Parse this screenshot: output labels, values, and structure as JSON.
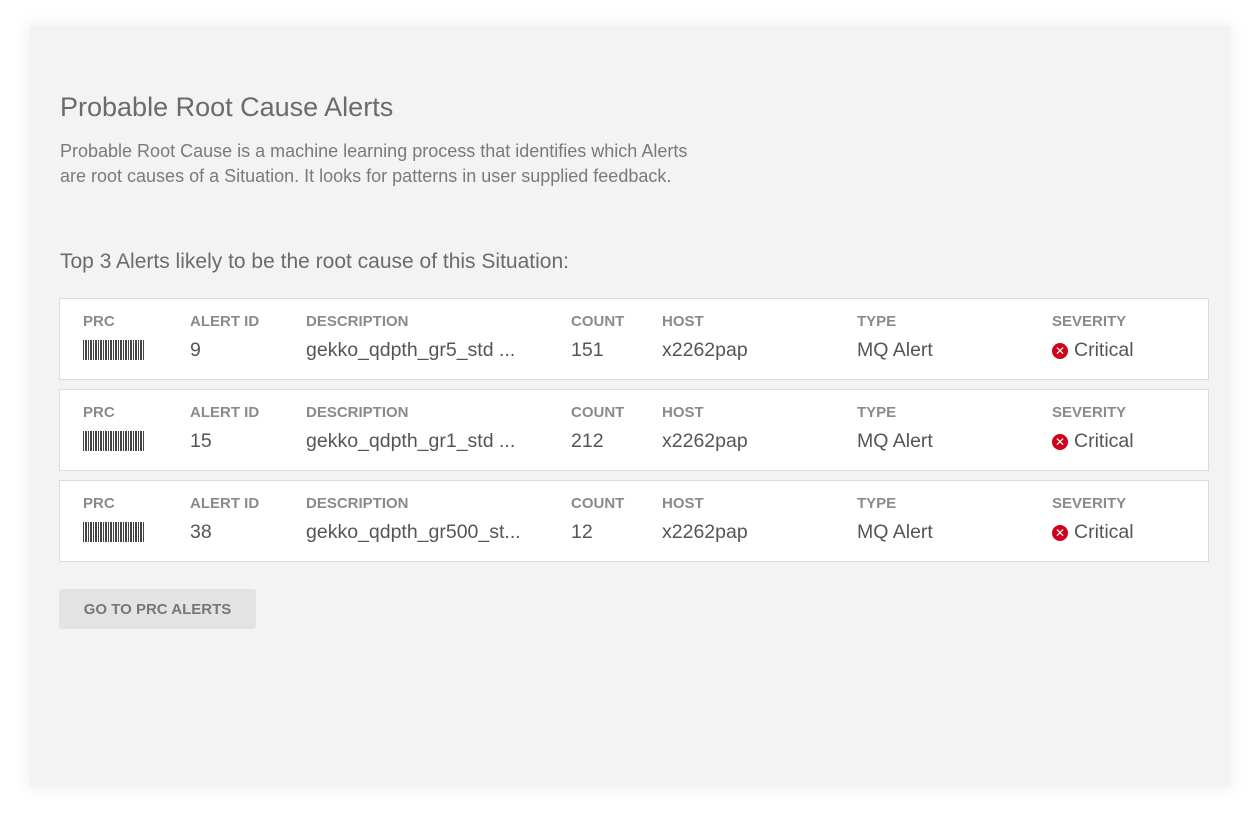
{
  "page": {
    "title": "Probable Root Cause Alerts",
    "intro": "Probable Root Cause is a machine learning process that identifies which Alerts are root causes of a Situation. It looks for patterns in user supplied feedback.",
    "subheading": "Top 3 Alerts likely to be the root cause of this Situation:"
  },
  "columns": {
    "prc": "PRC",
    "alert_id": "ALERT ID",
    "description": "DESCRIPTION",
    "count": "COUNT",
    "host": "HOST",
    "type": "TYPE",
    "severity": "SEVERITY"
  },
  "alerts": [
    {
      "alert_id": "9",
      "description": "gekko_qdpth_gr5_std ...",
      "count": "151",
      "host": "x2262pap",
      "type": "MQ Alert",
      "severity": "Critical"
    },
    {
      "alert_id": "15",
      "description": "gekko_qdpth_gr1_std ...",
      "count": "212",
      "host": "x2262pap",
      "type": "MQ Alert",
      "severity": "Critical"
    },
    {
      "alert_id": "38",
      "description": "gekko_qdpth_gr500_st...",
      "count": "12",
      "host": "x2262pap",
      "type": "MQ Alert",
      "severity": "Critical"
    }
  ],
  "icons": {
    "prc": "barcode-icon",
    "severity": "critical-icon",
    "severity_glyph": "✕"
  },
  "colors": {
    "critical": "#d0021b"
  },
  "actions": {
    "go_label": "GO TO PRC ALERTS"
  }
}
